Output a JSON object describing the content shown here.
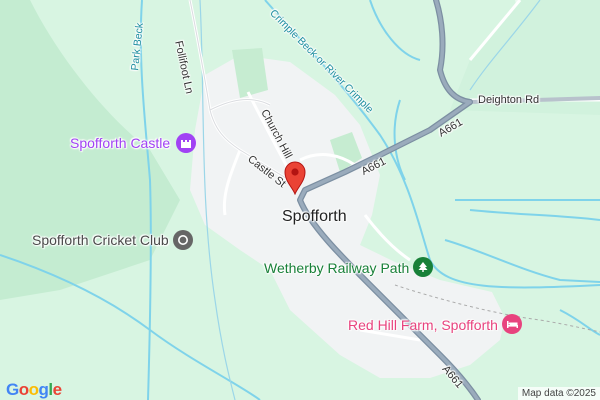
{
  "roads": {
    "follifoot_ln": "Follifoot Ln",
    "park_beck": "Park Beck",
    "church_hill": "Church Hill",
    "castle_st": "Castle St",
    "a661_north": "A661",
    "a661_south": "A661",
    "deighton_rd": "Deighton Rd"
  },
  "water": {
    "crimple_beck": "Crimple Beck or River Crimple"
  },
  "places": {
    "town": "Spofforth",
    "castle": "Spofforth Castle",
    "cricket_club": "Spofforth Cricket Club",
    "railway_path": "Wetherby Railway Path",
    "farm": "Red Hill Farm, Spofforth"
  },
  "colors": {
    "castle": "#a142f4",
    "cricket_club": "#666666",
    "railway_path": "#188038",
    "farm": "#e8437e",
    "pin": "#ea4335"
  },
  "icons": {
    "castle": "castle-icon",
    "cricket_club": "sports-icon",
    "railway_path": "tree-icon",
    "farm": "bed-icon",
    "pin": "location-pin-icon"
  },
  "branding": {
    "logo": "Google",
    "attribution": "Map data ©2025"
  }
}
